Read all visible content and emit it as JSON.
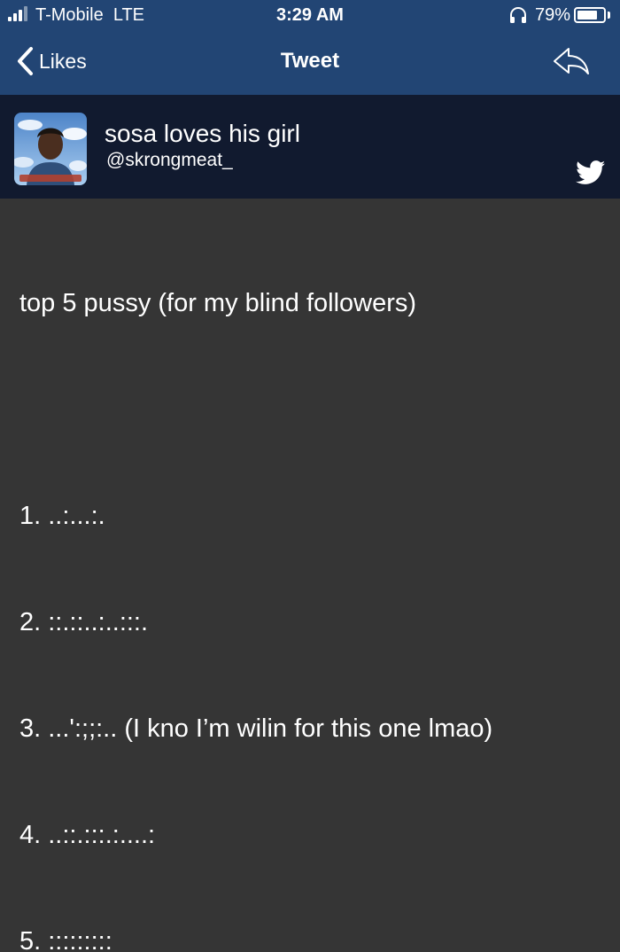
{
  "status_bar": {
    "carrier": "T-Mobile",
    "network": "LTE",
    "time": "3:29 AM",
    "battery": "79%",
    "battery_level": 0.79
  },
  "nav": {
    "back_label": "Likes",
    "title": "Tweet"
  },
  "tweet": {
    "author_name": "sosa loves his girl",
    "author_handle": "@skrongmeat_",
    "lines": [
      "top 5 pussy (for my blind followers)",
      "",
      "1. ..:...:.",
      "2. ::.::..:..:::.",
      "3. ...':;;:.. (I kno I’m wilin for this one lmao)",
      "4. ..::.:::.:....:",
      "5. :::::::::"
    ]
  },
  "colors": {
    "nav_bg": "#224574",
    "header_bg": "#111a2f",
    "body_bg": "#353535",
    "text": "#ffffff"
  }
}
